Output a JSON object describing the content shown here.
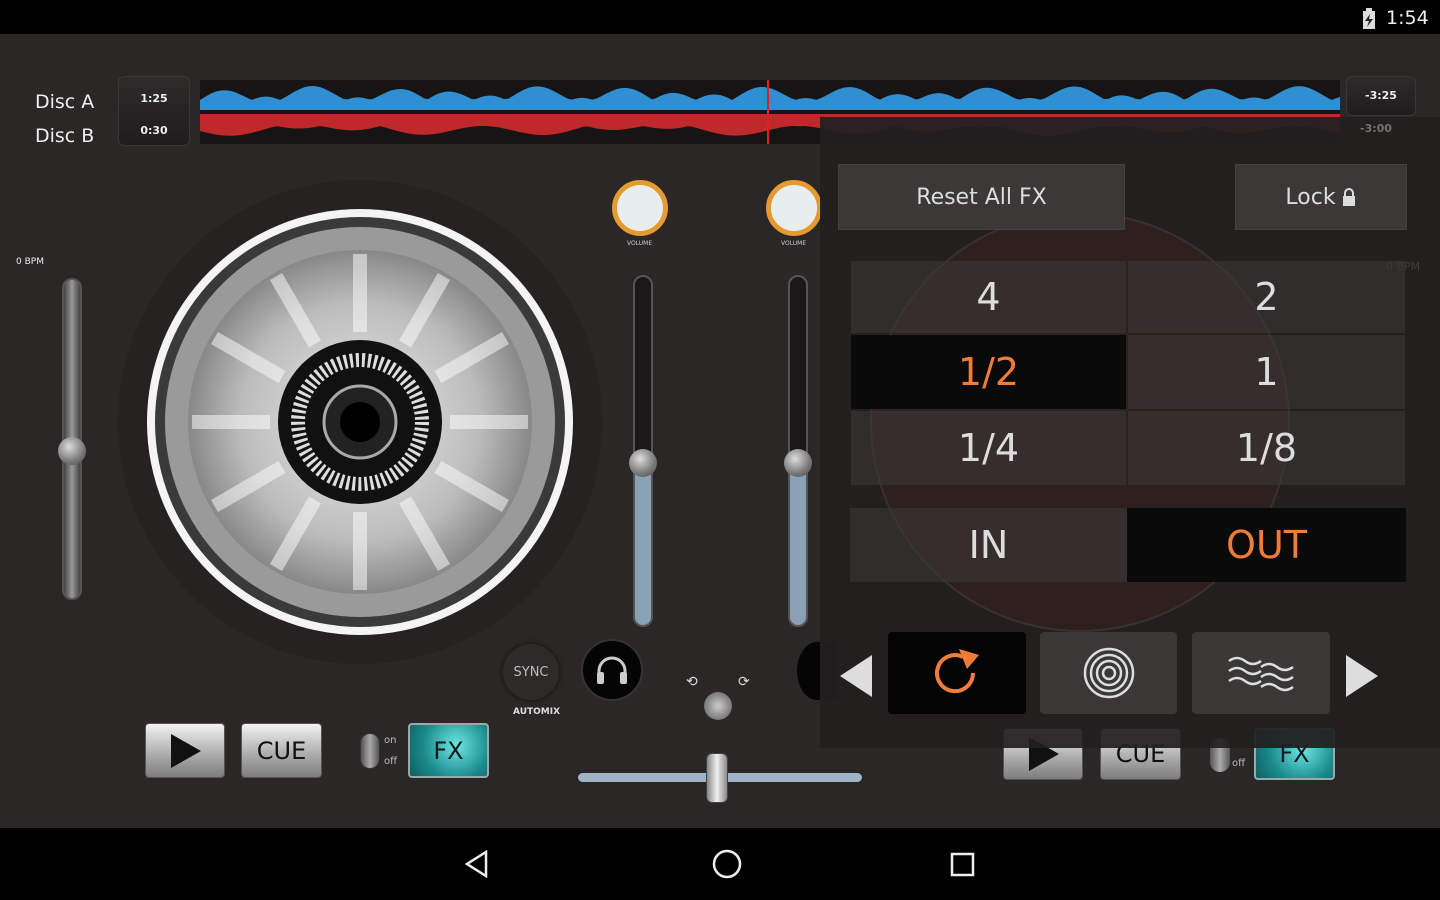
{
  "status_bar": {
    "time": "1:54",
    "battery_icon": "battery-charging-icon"
  },
  "decks": {
    "disc_a_label": "Disc A",
    "disc_b_label": "Disc B",
    "disc_a_elapsed": "1:25",
    "disc_b_elapsed": "0:30",
    "disc_a_remaining": "-3:25",
    "disc_b_remaining": "-3:00",
    "colors": {
      "disc_a": "#2f8fd0",
      "disc_b": "#c0292b"
    }
  },
  "left_deck": {
    "bpm": "0 BPM",
    "play_icon": "play-icon",
    "cue_label": "CUE",
    "toggle_on": "on",
    "toggle_off": "off",
    "fx_label": "FX",
    "pitch_position": 0.54
  },
  "mixer": {
    "volume_label": "VOLUME",
    "sync_label": "SYNC",
    "automix_label": "AUTOMIX",
    "headphone_icon": "headphones-icon",
    "crossfader_position": 0.49,
    "channel_a_level": 0.47,
    "channel_b_level": 0.47
  },
  "right_deck": {
    "bpm": "0 BPM",
    "cue_label": "CUE",
    "toggle_off": "off",
    "fx_label": "FX"
  },
  "fx_panel": {
    "reset_label": "Reset All FX",
    "lock_label": "Lock",
    "lock_icon": "lock-icon",
    "grid": [
      {
        "label": "4",
        "selected": false
      },
      {
        "label": "2",
        "selected": false
      },
      {
        "label": "1/2",
        "selected": true
      },
      {
        "label": "1",
        "selected": false
      },
      {
        "label": "1/4",
        "selected": false
      },
      {
        "label": "1/8",
        "selected": false
      }
    ],
    "in_label": "IN",
    "out_label": "OUT",
    "out_selected": true,
    "accent": "#f07c3a",
    "effects": [
      {
        "icon": "loop-icon",
        "selected": true
      },
      {
        "icon": "spiral-icon",
        "selected": false
      },
      {
        "icon": "waves-icon",
        "selected": false
      }
    ]
  },
  "nav_bar": {
    "back_icon": "back-icon",
    "home_icon": "home-icon",
    "recents_icon": "recents-icon"
  }
}
